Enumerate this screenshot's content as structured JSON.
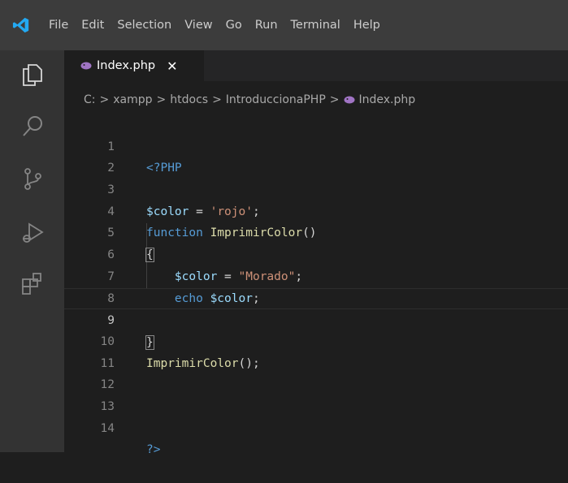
{
  "menu": {
    "items": [
      "File",
      "Edit",
      "Selection",
      "View",
      "Go",
      "Run",
      "Terminal",
      "Help"
    ]
  },
  "tab": {
    "label": "Index.php",
    "close": "✕"
  },
  "breadcrumb": {
    "parts": [
      "C:",
      "xampp",
      "htdocs",
      "IntroduccionaPHP",
      "Index.php"
    ],
    "separator": ">"
  },
  "code": {
    "lines": [
      {
        "n": "1",
        "text": "<?PHP"
      },
      {
        "n": "2",
        "text": ""
      },
      {
        "n": "3",
        "text": "$color = 'rojo';"
      },
      {
        "n": "4",
        "text": "function ImprimirColor()"
      },
      {
        "n": "5",
        "text": "{"
      },
      {
        "n": "6",
        "text": "    $color = \"Morado\";"
      },
      {
        "n": "7",
        "text": "    echo $color;"
      },
      {
        "n": "8",
        "text": ""
      },
      {
        "n": "9",
        "text": "}"
      },
      {
        "n": "10",
        "text": "ImprimirColor();"
      },
      {
        "n": "11",
        "text": ""
      },
      {
        "n": "12",
        "text": ""
      },
      {
        "n": "13",
        "text": ""
      },
      {
        "n": "14",
        "text": "?>"
      }
    ],
    "current_line": "9"
  },
  "colors": {
    "menubar": "#3c3c3c",
    "activitybar": "#333333",
    "editor": "#1e1e1e",
    "accent_logo": "#23a9f2",
    "php_icon": "#a074c4"
  },
  "icons": {
    "logo": "vscode-logo-icon",
    "activity": [
      "explorer-icon",
      "search-icon",
      "source-control-icon",
      "run-debug-icon",
      "extensions-icon"
    ],
    "file": "php-file-icon"
  }
}
